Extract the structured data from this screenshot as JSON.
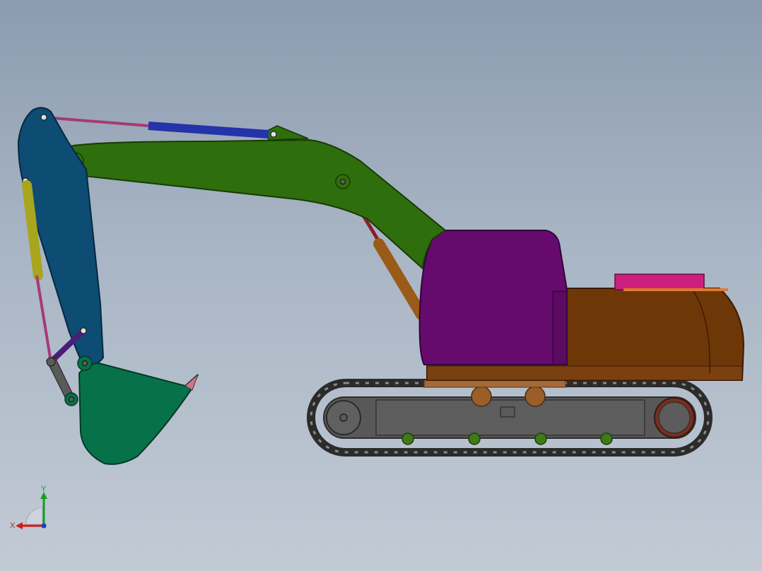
{
  "triad": {
    "x_label": "X",
    "y_label": "Y",
    "colors": {
      "x": "#d11a1a",
      "y": "#14a020",
      "z": "#1f3dc9"
    }
  },
  "parts": {
    "boom": {
      "color": "#2f6e0c",
      "icon": "excavator-boom"
    },
    "arm": {
      "color": "#0d4c73",
      "icon": "excavator-arm"
    },
    "bucket": {
      "color": "#07714a",
      "icon": "excavator-bucket"
    },
    "cab": {
      "color": "#660a6e",
      "icon": "cab"
    },
    "upper_body": {
      "color": "#6e3708",
      "icon": "upper-structure"
    },
    "counterweight_top": {
      "color": "#cc1f80",
      "icon": "engine-cover"
    },
    "track": {
      "color": "#3a3a3a",
      "icon": "crawler-track"
    },
    "arm_cylinder": {
      "color": "#2433a8",
      "icon": "hydraulic-cylinder"
    },
    "bucket_cylinder": {
      "color": "#a8a51e",
      "icon": "hydraulic-cylinder"
    },
    "boom_cylinder": {
      "color": "#9a5a18",
      "icon": "hydraulic-cylinder"
    }
  }
}
